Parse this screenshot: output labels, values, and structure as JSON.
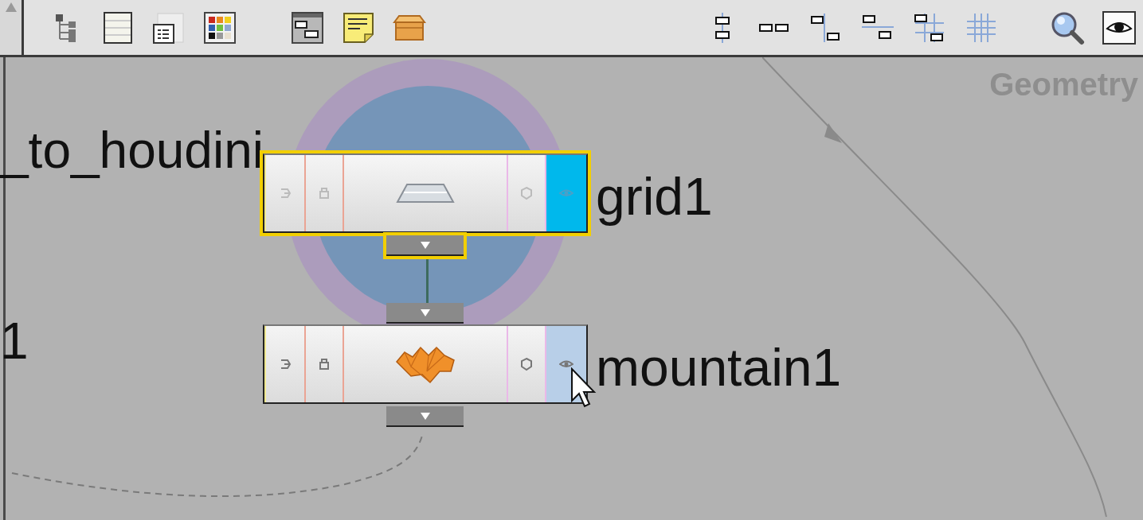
{
  "canvas": {
    "context_label": "Geometry",
    "clipped_labels": [
      {
        "text": "_to_houdini"
      },
      {
        "text": "1"
      }
    ]
  },
  "nodes": [
    {
      "name": "grid1",
      "kind": "grid",
      "selected": true,
      "display": true
    },
    {
      "name": "mountain1",
      "kind": "mountain",
      "selected": false,
      "display": false
    }
  ]
}
